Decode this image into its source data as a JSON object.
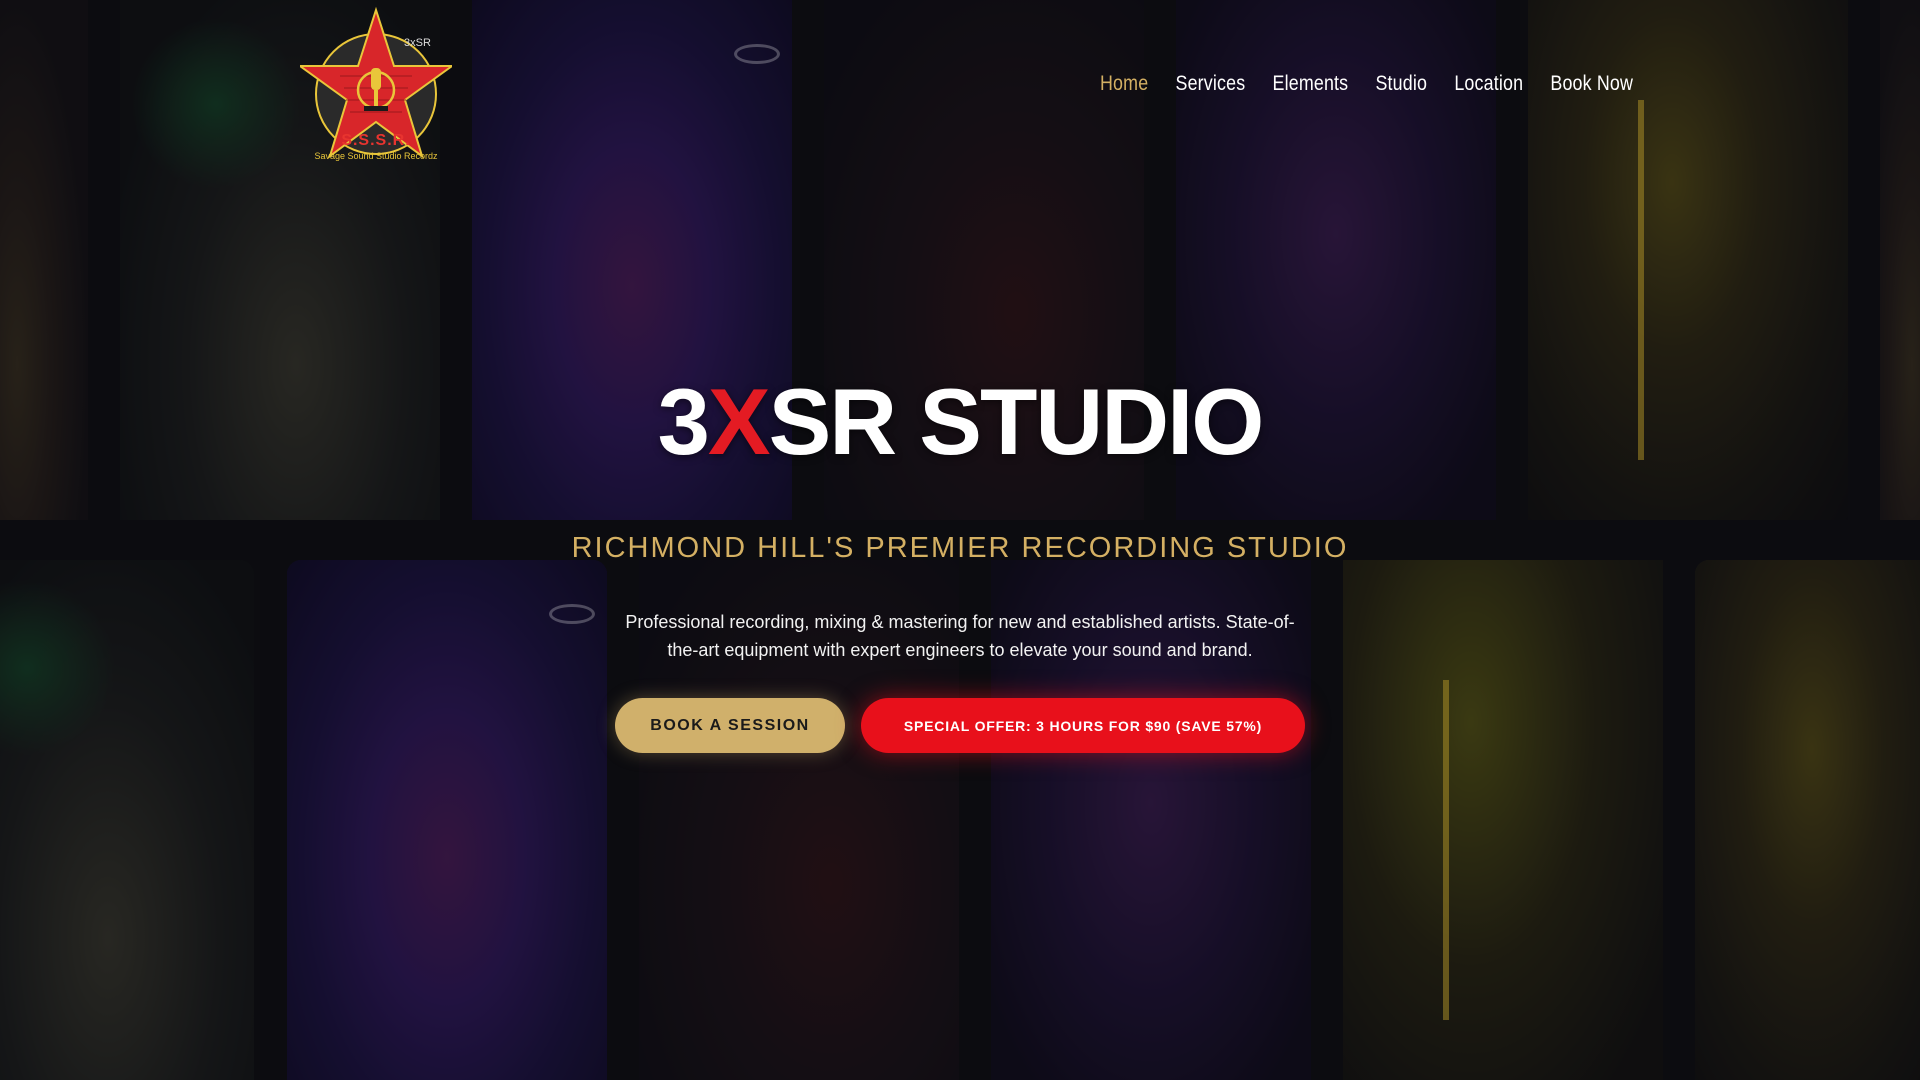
{
  "brand": {
    "logo_initials": "S.S.S.R.",
    "logo_name": "Savage Sound Studio",
    "logo_suffix": "Recordz",
    "logo_tag": "3xSR",
    "colors": {
      "red": "#e41b23",
      "gold": "#d4b063",
      "logo_yellow": "#e9c63a"
    }
  },
  "nav": {
    "items": [
      {
        "label": "Home",
        "active": true
      },
      {
        "label": "Services",
        "active": false
      },
      {
        "label": "Elements",
        "active": false
      },
      {
        "label": "Studio",
        "active": false
      },
      {
        "label": "Location",
        "active": false
      },
      {
        "label": "Book Now",
        "active": false
      }
    ]
  },
  "hero": {
    "title_prefix": "3",
    "title_accent": "X",
    "title_suffix": "SR STUDIO",
    "subtitle": "RICHMOND HILL'S PREMIER RECORDING STUDIO",
    "description": "Professional recording, mixing & mastering for new and established artists. State-of-the-art equipment with expert engineers to elevate your sound and brand.",
    "primary_button": "BOOK A SESSION",
    "offer_button": "SPECIAL OFFER: 3 HOURS FOR $90 (SAVE 57%)"
  }
}
